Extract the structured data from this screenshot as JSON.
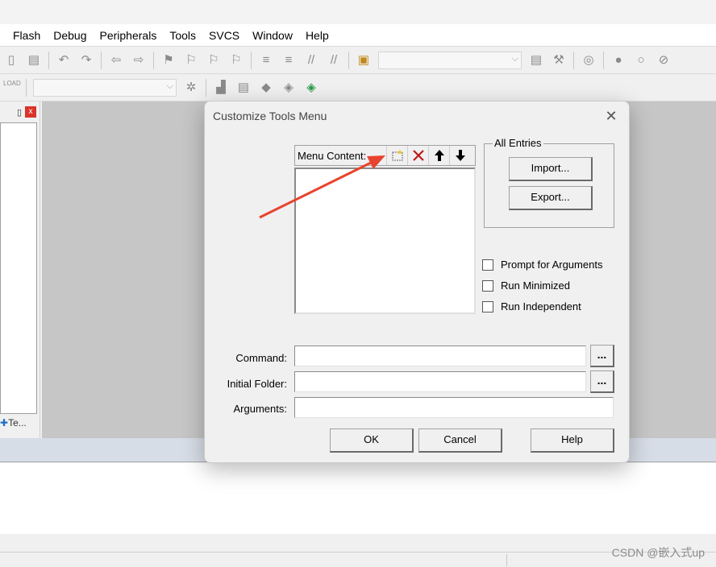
{
  "menubar": {
    "items": [
      "Flash",
      "Debug",
      "Peripherals",
      "Tools",
      "SVCS",
      "Window",
      "Help"
    ]
  },
  "toolbar": {
    "load_label": "LOAD"
  },
  "left_panel": {
    "pin_glyph": "❀",
    "close_glyph": "x",
    "tab_label": "Te..."
  },
  "dialog": {
    "title": "Customize Tools Menu",
    "close_glyph": "✕",
    "menu_content": {
      "label": "Menu Content:",
      "new_icon": "new-item-icon",
      "delete_icon": "delete-icon",
      "up_icon": "move-up-icon",
      "down_icon": "move-down-icon"
    },
    "all_entries": {
      "legend": "All Entries",
      "import_label": "Import...",
      "export_label": "Export..."
    },
    "options": {
      "prompt_args": "Prompt for  Arguments",
      "run_minimized": "Run Minimized",
      "run_independent": "Run Independent"
    },
    "fields": {
      "command_label": "Command:",
      "command_value": "",
      "initial_folder_label": "Initial Folder:",
      "initial_folder_value": "",
      "arguments_label": "Arguments:",
      "arguments_value": "",
      "browse_label": "..."
    },
    "buttons": {
      "ok": "OK",
      "cancel": "Cancel",
      "help": "Help"
    }
  },
  "annotation": {
    "arrow_color": "#e8432f"
  },
  "watermark": "CSDN @嵌入式up"
}
